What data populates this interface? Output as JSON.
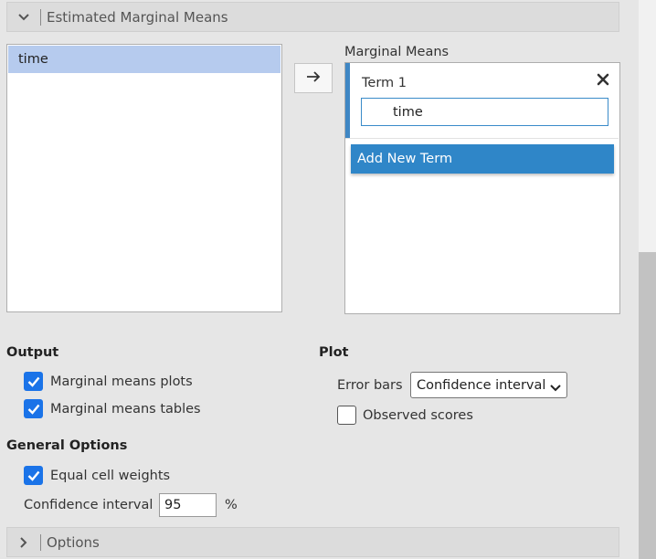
{
  "emm_section": {
    "title": "Estimated Marginal Means",
    "icon": "chevron-down-icon"
  },
  "variables": {
    "items": [
      "time"
    ]
  },
  "transfer_button": {
    "icon": "arrow-right-icon"
  },
  "marginal_means": {
    "label": "Marginal Means",
    "terms": [
      {
        "label": "Term 1",
        "value": "time"
      }
    ],
    "remove_icon": "close-icon",
    "add_term_label": "Add New Term"
  },
  "output": {
    "title": "Output",
    "plots_label": "Marginal means plots",
    "plots_checked": true,
    "tables_label": "Marginal means tables",
    "tables_checked": true
  },
  "plot": {
    "title": "Plot",
    "error_bars_label": "Error bars",
    "error_bars_value": "Confidence interval",
    "observed_label": "Observed scores",
    "observed_checked": false
  },
  "general_options": {
    "title": "General Options",
    "equal_weights_label": "Equal cell weights",
    "equal_weights_checked": true,
    "ci_label": "Confidence interval",
    "ci_value": "95",
    "ci_unit": "%"
  },
  "options_section": {
    "title": "Options",
    "icon": "chevron-right-icon"
  },
  "colors": {
    "accent": "#2f86c8",
    "checkbox": "#1a73e8",
    "selected_row": "#b6cbee"
  }
}
